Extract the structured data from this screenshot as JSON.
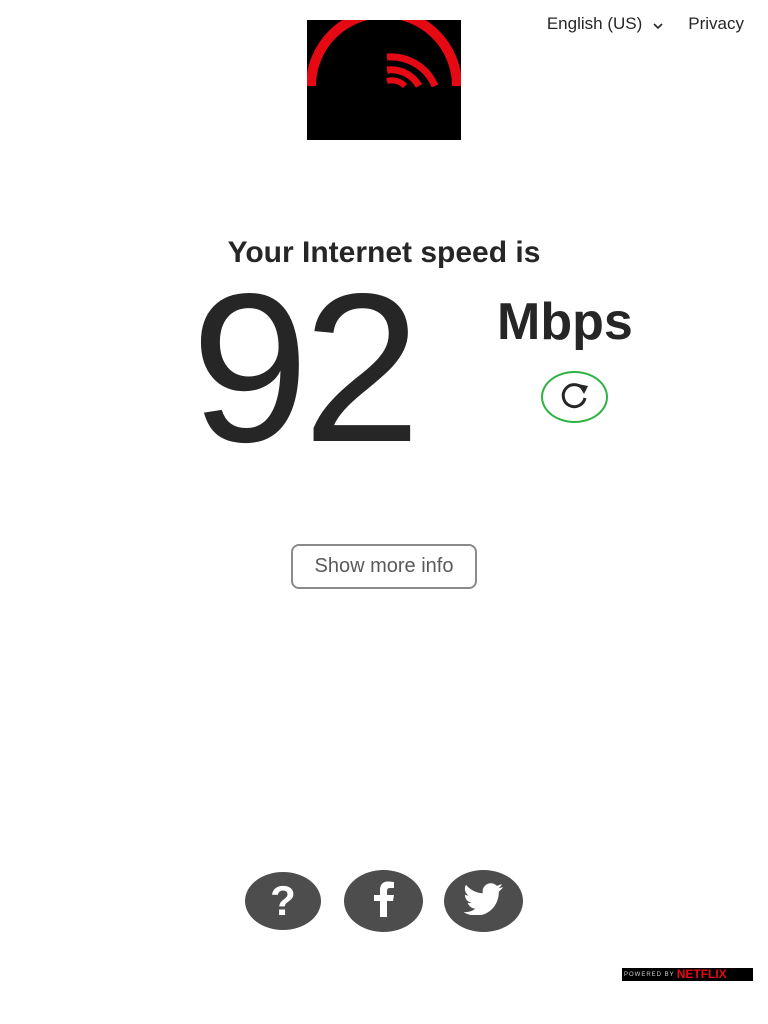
{
  "header": {
    "language_label": "English (US)",
    "privacy_label": "Privacy"
  },
  "logo": {
    "name": "fast-logo",
    "accent_color": "#e50914",
    "background_color": "#000000"
  },
  "result": {
    "headline": "Your Internet speed is",
    "speed_value": "92",
    "speed_units": "Mbps",
    "reload_icon": "reload-icon",
    "reload_ring_color": "#2fb344"
  },
  "actions": {
    "more_info_label": "Show more info"
  },
  "social": {
    "help_glyph": "?",
    "items": [
      "help-icon",
      "facebook-icon",
      "twitter-icon"
    ],
    "button_color": "#4d4d4d"
  },
  "footer": {
    "powered_by_label": "POWERED BY",
    "brand_label": "NETFLIX",
    "brand_color": "#e50914"
  }
}
